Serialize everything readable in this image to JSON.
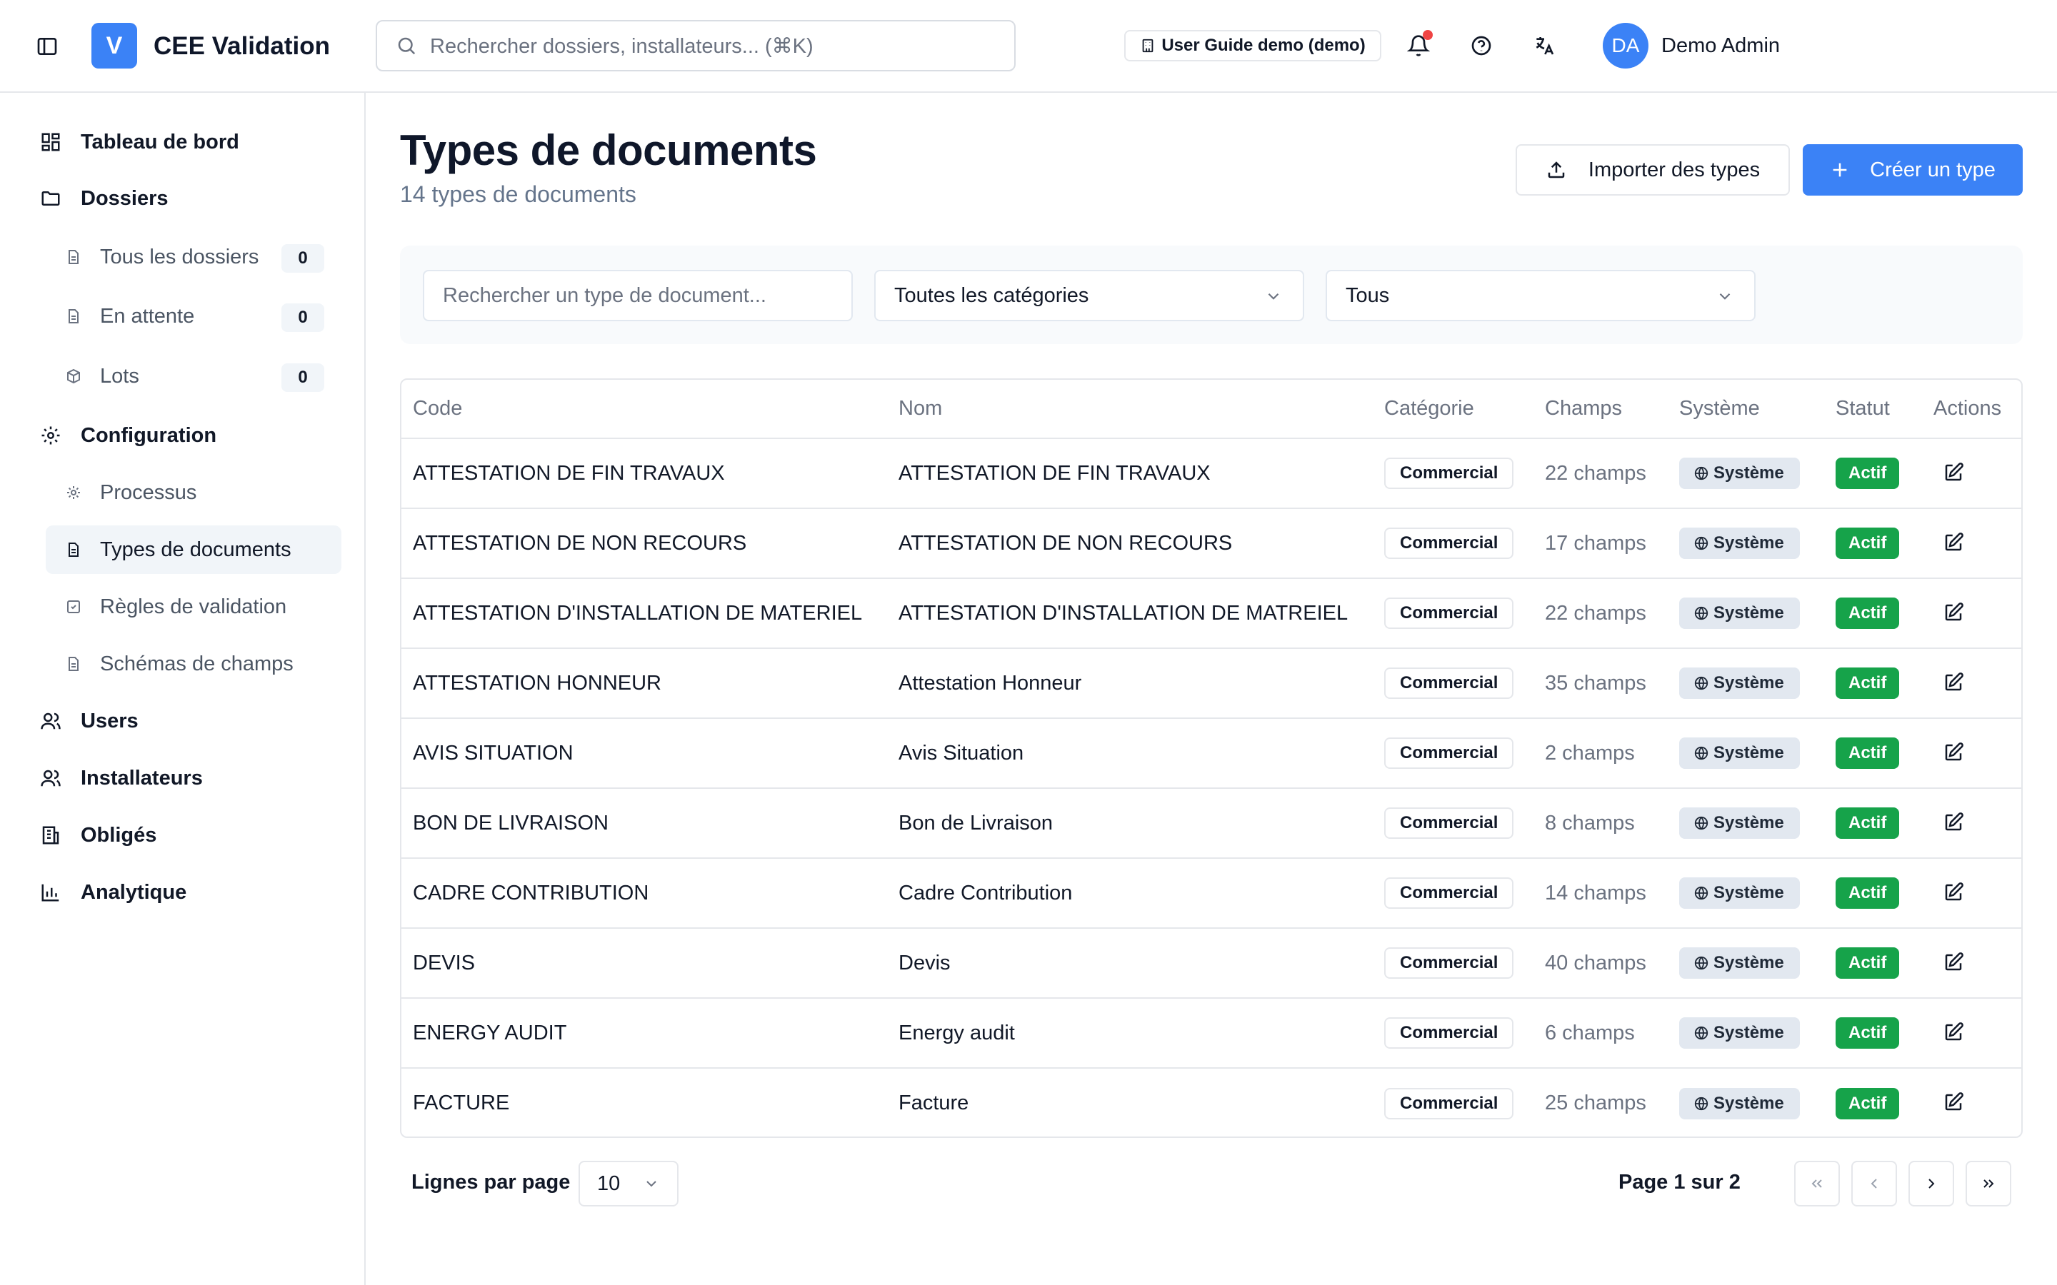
{
  "header": {
    "app_initial": "V",
    "app_title": "CEE Validation",
    "search_placeholder": "Rechercher dossiers, installateurs... (⌘K)",
    "guide_badge": "User Guide demo (demo)",
    "avatar_initials": "DA",
    "user_name": "Demo Admin",
    "notification_dot_color": "#ef4444"
  },
  "sidebar": {
    "dashboard": "Tableau de bord",
    "dossiers": "Dossiers",
    "all_dossiers": "Tous les dossiers",
    "all_dossiers_count": "0",
    "pending": "En attente",
    "pending_count": "0",
    "lots": "Lots",
    "lots_count": "0",
    "configuration": "Configuration",
    "processus": "Processus",
    "doc_types": "Types de documents",
    "validation_rules": "Règles de validation",
    "field_schemas": "Schémas de champs",
    "users": "Users",
    "installers": "Installateurs",
    "obliges": "Obligés",
    "analytics": "Analytique"
  },
  "main": {
    "title": "Types de documents",
    "subtitle": "14 types de documents",
    "import_label": "Importer des types",
    "create_label": "Créer un type",
    "filter_search_placeholder": "Rechercher un type de document...",
    "filter_category": "Toutes les catégories",
    "filter_status": "Tous"
  },
  "table": {
    "headers": {
      "code": "Code",
      "name": "Nom",
      "category": "Catégorie",
      "fields": "Champs",
      "system": "Système",
      "status": "Statut",
      "actions": "Actions"
    },
    "rows": [
      {
        "code": "ATTESTATION DE FIN TRAVAUX",
        "name": "ATTESTATION DE FIN TRAVAUX",
        "category": "Commercial",
        "fields": "22 champs",
        "system": "Système",
        "status": "Actif"
      },
      {
        "code": "ATTESTATION DE NON RECOURS",
        "name": "ATTESTATION DE NON RECOURS",
        "category": "Commercial",
        "fields": "17 champs",
        "system": "Système",
        "status": "Actif"
      },
      {
        "code": "ATTESTATION D'INSTALLATION DE MATERIEL",
        "name": "ATTESTATION D'INSTALLATION DE MATREIEL",
        "category": "Commercial",
        "fields": "22 champs",
        "system": "Système",
        "status": "Actif"
      },
      {
        "code": "ATTESTATION HONNEUR",
        "name": "Attestation Honneur",
        "category": "Commercial",
        "fields": "35 champs",
        "system": "Système",
        "status": "Actif"
      },
      {
        "code": "AVIS SITUATION",
        "name": "Avis Situation",
        "category": "Commercial",
        "fields": "2 champs",
        "system": "Système",
        "status": "Actif"
      },
      {
        "code": "BON DE LIVRAISON",
        "name": "Bon de Livraison",
        "category": "Commercial",
        "fields": "8 champs",
        "system": "Système",
        "status": "Actif"
      },
      {
        "code": "CADRE CONTRIBUTION",
        "name": "Cadre Contribution",
        "category": "Commercial",
        "fields": "14 champs",
        "system": "Système",
        "status": "Actif"
      },
      {
        "code": "DEVIS",
        "name": "Devis",
        "category": "Commercial",
        "fields": "40 champs",
        "system": "Système",
        "status": "Actif"
      },
      {
        "code": "ENERGY AUDIT",
        "name": "Energy audit",
        "category": "Commercial",
        "fields": "6 champs",
        "system": "Système",
        "status": "Actif"
      },
      {
        "code": "FACTURE",
        "name": "Facture",
        "category": "Commercial",
        "fields": "25 champs",
        "system": "Système",
        "status": "Actif"
      }
    ]
  },
  "pagination": {
    "rows_label": "Lignes par page",
    "rows_value": "10",
    "page_info": "Page 1 sur 2"
  },
  "colors": {
    "accent": "#3b82f6",
    "status_active": "#16a34a",
    "system_badge_bg": "#e2e8f0"
  },
  "icons": [
    "sidebar-toggle-icon",
    "search-icon",
    "building-icon",
    "bell-icon",
    "help-circle-icon",
    "translate-icon",
    "dashboard-icon",
    "folder-icon",
    "file-icon",
    "package-icon",
    "gear-icon",
    "file-check-icon",
    "users-icon",
    "building-columns-icon",
    "bar-chart-icon",
    "upload-icon",
    "plus-icon",
    "chevron-down-icon",
    "globe-icon",
    "edit-icon",
    "chevrons-left-icon",
    "chevron-left-icon",
    "chevron-right-icon",
    "chevrons-right-icon"
  ]
}
